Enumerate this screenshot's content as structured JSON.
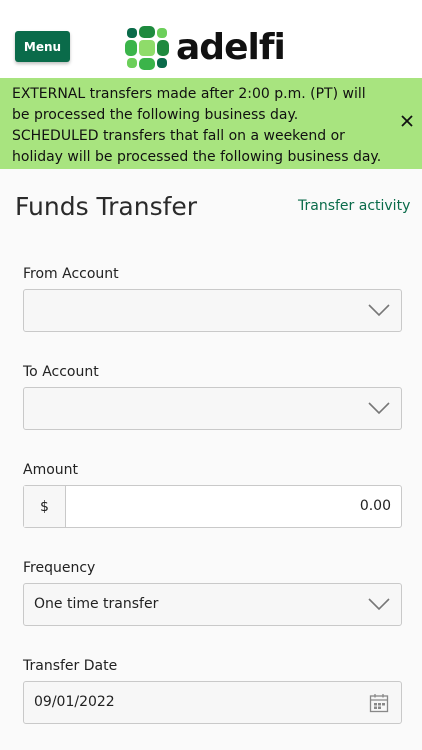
{
  "header": {
    "menu_label": "Menu",
    "logo_text": "adelfi",
    "brand_color": "#0a6b4a"
  },
  "alert": {
    "message": "EXTERNAL transfers made after 2:00 p.m. (PT) will be processed the following business day. SCHEDULED transfers that fall on a weekend or holiday will be processed the following business day.",
    "close_icon": "close-icon",
    "background": "#a8e47f"
  },
  "page": {
    "title": "Funds Transfer",
    "activity_link": "Transfer activity"
  },
  "form": {
    "from_account": {
      "label": "From Account",
      "value": ""
    },
    "to_account": {
      "label": "To Account",
      "value": ""
    },
    "amount": {
      "label": "Amount",
      "currency": "$",
      "value": "0.00"
    },
    "frequency": {
      "label": "Frequency",
      "value": "One time transfer"
    },
    "transfer_date": {
      "label": "Transfer Date",
      "value": "09/01/2022"
    }
  }
}
